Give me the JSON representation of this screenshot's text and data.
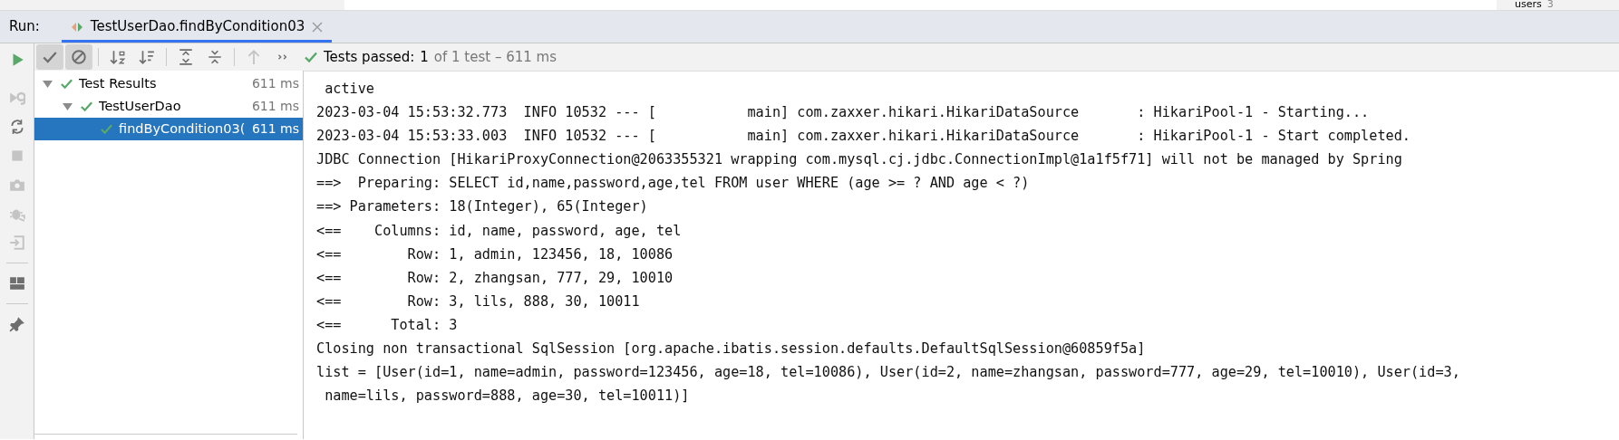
{
  "top_strip": {
    "tree_label": "users",
    "tree_count": "3"
  },
  "run_bar": {
    "label": "Run:",
    "tabs": [
      {
        "title": "TestUserDao.findByCondition03",
        "selected": true
      }
    ]
  },
  "side_actions": [
    [
      {
        "kind": "rerun",
        "disabled": false
      },
      {
        "kind": "rerun_failed",
        "disabled": true
      },
      {
        "kind": "toggle_auto",
        "disabled": false
      },
      {
        "kind": "stop",
        "disabled": true
      },
      {
        "kind": "camera",
        "disabled": true
      },
      {
        "kind": "debug_export",
        "disabled": true
      },
      {
        "kind": "import",
        "disabled": true
      }
    ],
    [
      {
        "kind": "layout",
        "disabled": false
      }
    ],
    [
      {
        "kind": "pin",
        "disabled": false
      }
    ]
  ],
  "toolbar": {
    "groups": [
      [
        {
          "kind": "show_passed",
          "on": true
        },
        {
          "kind": "show_ignored",
          "on": true
        }
      ],
      [
        {
          "kind": "sort_alpha",
          "on": false
        },
        {
          "kind": "sort_duration",
          "on": false
        }
      ],
      [
        {
          "kind": "expand_all",
          "on": false
        },
        {
          "kind": "collapse_all",
          "on": false
        }
      ],
      [
        {
          "kind": "previous",
          "on": false,
          "disabled": true
        }
      ],
      [
        {
          "kind": "more",
          "on": false
        }
      ]
    ],
    "status": {
      "passed": true,
      "prefix": "Tests passed:",
      "count": "1",
      "rest": "of 1 test – 611 ms"
    }
  },
  "tree": [
    {
      "label": "Test Results",
      "time": "611 ms",
      "passed": true,
      "expanded": true,
      "selected": false,
      "children": [
        {
          "label": "TestUserDao",
          "time": "611 ms",
          "passed": true,
          "expanded": true,
          "selected": false,
          "children": [
            {
              "label": "findByCondition03(",
              "time": "611 ms",
              "passed": true,
              "selected": true
            }
          ]
        }
      ]
    }
  ],
  "console": {
    "lines": [
      " active",
      "2023-03-04 15:53:32.773  INFO 10532 --- [           main] com.zaxxer.hikari.HikariDataSource       : HikariPool-1 - Starting...",
      "2023-03-04 15:53:33.003  INFO 10532 --- [           main] com.zaxxer.hikari.HikariDataSource       : HikariPool-1 - Start completed.",
      "JDBC Connection [HikariProxyConnection@2063355321 wrapping com.mysql.cj.jdbc.ConnectionImpl@1a1f5f71] will not be managed by Spring",
      "==>  Preparing: SELECT id,name,password,age,tel FROM user WHERE (age >= ? AND age < ?)",
      "==> Parameters: 18(Integer), 65(Integer)",
      "<==    Columns: id, name, password, age, tel",
      "<==        Row: 1, admin, 123456, 18, 10086",
      "<==        Row: 2, zhangsan, 777, 29, 10010",
      "<==        Row: 3, lils, 888, 30, 10011",
      "<==      Total: 3",
      "Closing non transactional SqlSession [org.apache.ibatis.session.defaults.DefaultSqlSession@60859f5a]",
      "list = [User(id=1, name=admin, password=123456, age=18, tel=10086), User(id=2, name=zhangsan, password=777, age=29, tel=10010), User(id=3,",
      " name=lils, password=888, age=30, tel=10011)]"
    ]
  }
}
